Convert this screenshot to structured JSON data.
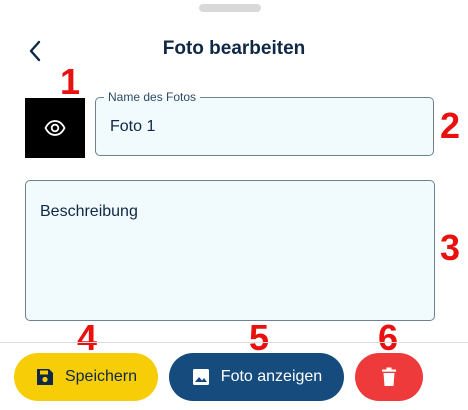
{
  "header": {
    "title": "Foto bearbeiten",
    "back_icon": "chevron-left-icon"
  },
  "markers": [
    "1",
    "2",
    "3",
    "4",
    "5",
    "6"
  ],
  "photo": {
    "preview_icon": "eye-icon"
  },
  "name_field": {
    "label": "Name des Fotos",
    "value": "Foto 1"
  },
  "description_field": {
    "placeholder": "Beschreibung",
    "value": ""
  },
  "actions": {
    "save_label": "Speichern",
    "save_icon": "save-icon",
    "show_label": "Foto anzeigen",
    "show_icon": "image-icon",
    "delete_icon": "trash-icon"
  },
  "colors": {
    "text": "#0f2845",
    "marker": "#e8110f",
    "save_button": "#f6cd07",
    "show_button": "#164b7e",
    "delete_button": "#ee3a3a",
    "field_background": "#f1fafd"
  }
}
